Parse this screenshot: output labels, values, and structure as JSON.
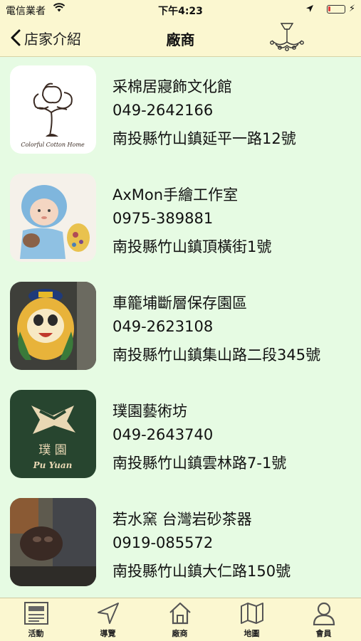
{
  "status_bar": {
    "carrier": "電信業者",
    "time": "下午4:23",
    "battery_level": 0.15,
    "battery_color": "#e23b3b"
  },
  "nav": {
    "back_label": "店家介紹",
    "title": "廠商"
  },
  "vendors": [
    {
      "name": "采棉居寢飾文化館",
      "phone": "049-2642166",
      "address": "南投縣竹山鎮延平一路12號",
      "logo_text": "Colorful Cotton Home"
    },
    {
      "name": "AxMon手繪工作室",
      "phone": "0975-389881",
      "address": "南投縣竹山鎮頂橫街1號"
    },
    {
      "name": "車籠埔斷層保存園區",
      "phone": "049-2623108",
      "address": "南投縣竹山鎮集山路二段345號"
    },
    {
      "name": "璞園藝術坊",
      "phone": "049-2643740",
      "address": "南投縣竹山鎮雲林路7-1號",
      "logo_text": "璞 園",
      "logo_subtext": "Pu Yuan"
    },
    {
      "name": "若水窯 台灣岩砂茶器",
      "phone": "0919-085572",
      "address": "南投縣竹山鎮大仁路150號"
    }
  ],
  "tabs": [
    {
      "label": "活動",
      "icon": "newspaper-icon"
    },
    {
      "label": "導覽",
      "icon": "navigation-arrow-icon"
    },
    {
      "label": "廠商",
      "icon": "home-icon"
    },
    {
      "label": "地圖",
      "icon": "map-icon"
    },
    {
      "label": "會員",
      "icon": "person-icon"
    }
  ],
  "colors": {
    "bar_background": "#fbf7d0",
    "page_background": "#e6fbe3",
    "puyuan_green": "#27452f"
  }
}
